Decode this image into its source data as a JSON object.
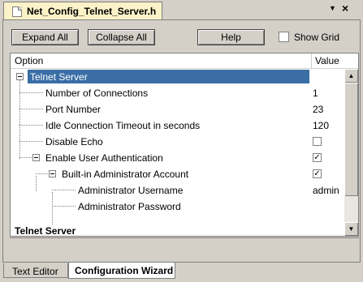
{
  "window": {
    "file_tab_title": "Net_Config_Telnet_Server.h",
    "dropdown_icon": "dropdown-arrow-icon",
    "close_icon": "close-icon"
  },
  "toolbar": {
    "expand_all": "Expand All",
    "collapse_all": "Collapse All",
    "help": "Help",
    "show_grid": "Show Grid",
    "show_grid_checked": false
  },
  "tree": {
    "columns": {
      "option": "Option",
      "value": "Value"
    },
    "rows": [
      {
        "label": "Telnet Server",
        "value": "",
        "selected": true
      },
      {
        "label": "Number of Connections",
        "value": "1"
      },
      {
        "label": "Port Number",
        "value": "23"
      },
      {
        "label": "Idle Connection Timeout in seconds",
        "value": "120"
      },
      {
        "label": "Disable Echo",
        "checked": false
      },
      {
        "label": "Enable User Authentication",
        "checked": true
      },
      {
        "label": "Built-in Administrator Account",
        "checked": true
      },
      {
        "label": "Administrator Username",
        "value": "admin"
      },
      {
        "label": "Administrator Password",
        "value": ""
      }
    ]
  },
  "description": {
    "title": "Telnet Server"
  },
  "bottom_tabs": {
    "text_editor": "Text Editor",
    "config_wizard": "Configuration Wizard"
  },
  "colors": {
    "selection": "#3a6ea5",
    "file_tab_bg": "#fbf3c7",
    "chrome": "#d4d0c8"
  }
}
